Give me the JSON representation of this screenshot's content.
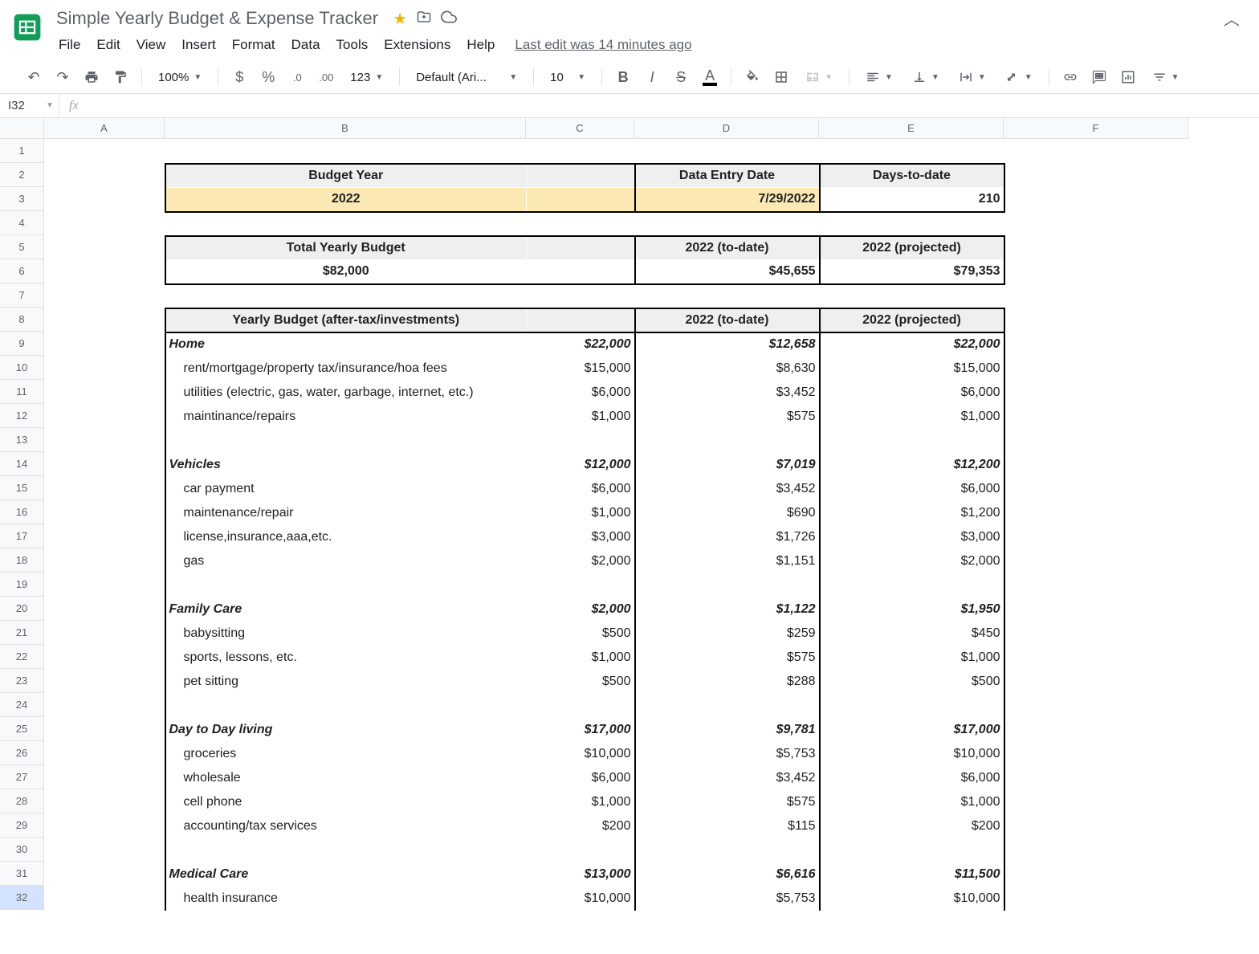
{
  "doc": {
    "title": "Simple Yearly Budget & Expense Tracker",
    "last_edit": "Last edit was 14 minutes ago"
  },
  "menus": [
    "File",
    "Edit",
    "View",
    "Insert",
    "Format",
    "Data",
    "Tools",
    "Extensions",
    "Help"
  ],
  "toolbar": {
    "zoom": "100%",
    "font": "Default (Ari...",
    "font_size": "10",
    "number_format": "123"
  },
  "name_box": "I32",
  "columns": [
    "A",
    "B",
    "C",
    "D",
    "E",
    "F"
  ],
  "row_count": 32,
  "selected_row": 32,
  "header1": {
    "budget_year_label": "Budget Year",
    "data_entry_label": "Data Entry Date",
    "days_label": "Days-to-date",
    "budget_year": "2022",
    "data_entry": "7/29/2022",
    "days": "210"
  },
  "header2": {
    "total_budget_label": "Total Yearly Budget",
    "to_date_label": "2022 (to-date)",
    "projected_label": "2022 (projected)",
    "total_budget": "$82,000",
    "to_date": "$45,655",
    "projected": "$79,353"
  },
  "header3": {
    "yearly_budget_label": "Yearly Budget (after-tax/investments)",
    "to_date_label": "2022 (to-date)",
    "projected_label": "2022 (projected)"
  },
  "categories": [
    {
      "name": "Home",
      "budget": "$22,000",
      "to_date": "$12,658",
      "projected": "$22,000",
      "proj_class": "bold italic",
      "items": [
        {
          "name": "rent/mortgage/property tax/insurance/hoa fees",
          "budget": "$15,000",
          "to_date": "$8,630",
          "projected": "$15,000"
        },
        {
          "name": "utilities (electric, gas, water, garbage, internet, etc.)",
          "budget": "$6,000",
          "to_date": "$3,452",
          "projected": "$6,000"
        },
        {
          "name": "maintinance/repairs",
          "budget": "$1,000",
          "to_date": "$575",
          "projected": "$1,000"
        }
      ]
    },
    {
      "name": "Vehicles",
      "budget": "$12,000",
      "to_date": "$7,019",
      "projected": "$12,200",
      "proj_class": "red-bi",
      "items": [
        {
          "name": "car payment",
          "budget": "$6,000",
          "to_date": "$3,452",
          "projected": "$6,000"
        },
        {
          "name": "maintenance/repair",
          "budget": "$1,000",
          "to_date": "$690",
          "projected": "$1,200",
          "proj_item_class": "red"
        },
        {
          "name": "license,insurance,aaa,etc.",
          "budget": "$3,000",
          "to_date": "$1,726",
          "projected": "$3,000"
        },
        {
          "name": "gas",
          "budget": "$2,000",
          "to_date": "$1,151",
          "projected": "$2,000"
        }
      ]
    },
    {
      "name": "Family Care",
      "budget": "$2,000",
      "to_date": "$1,122",
      "projected": "$1,950",
      "proj_class": "green-bi",
      "items": [
        {
          "name": "babysitting",
          "budget": "$500",
          "to_date": "$259",
          "projected": "$450",
          "proj_item_class": "green"
        },
        {
          "name": "sports, lessons, etc.",
          "budget": "$1,000",
          "to_date": "$575",
          "projected": "$1,000"
        },
        {
          "name": "pet sitting",
          "budget": "$500",
          "to_date": "$288",
          "projected": "$500"
        }
      ]
    },
    {
      "name": "Day to Day living",
      "budget": "$17,000",
      "to_date": "$9,781",
      "projected": "$17,000",
      "proj_class": "bold italic",
      "items": [
        {
          "name": "groceries",
          "budget": "$10,000",
          "to_date": "$5,753",
          "projected": "$10,000"
        },
        {
          "name": "wholesale",
          "budget": "$6,000",
          "to_date": "$3,452",
          "projected": "$6,000"
        },
        {
          "name": "cell phone",
          "budget": "$1,000",
          "to_date": "$575",
          "projected": "$1,000"
        },
        {
          "name": "accounting/tax services",
          "budget": "$200",
          "to_date": "$115",
          "projected": "$200"
        }
      ]
    },
    {
      "name": "Medical Care",
      "budget": "$13,000",
      "to_date": "$6,616",
      "projected": "$11,500",
      "proj_class": "green-bi",
      "items": [
        {
          "name": "health insurance",
          "budget": "$10,000",
          "to_date": "$5,753",
          "projected": "$10,000"
        }
      ]
    }
  ]
}
